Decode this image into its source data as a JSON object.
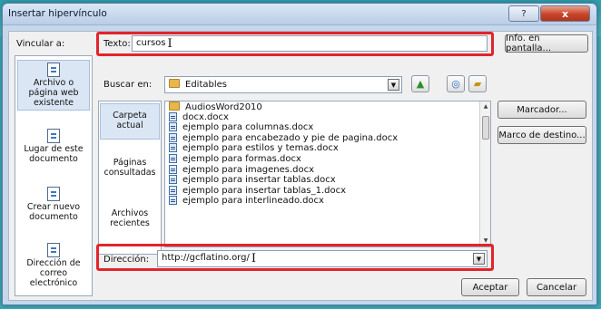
{
  "window": {
    "title": "Insertar hipervínculo",
    "help_glyph": "?",
    "close_glyph": "x"
  },
  "link_to": {
    "label": "Vincular a:",
    "items": [
      {
        "label": "Archivo o página web existente",
        "icon": "web-page-icon",
        "selected": true
      },
      {
        "label": "Lugar de este documento",
        "icon": "document-place-icon"
      },
      {
        "label": "Crear nuevo documento",
        "icon": "new-document-icon"
      },
      {
        "label": "Dirección de correo electrónico",
        "icon": "email-icon"
      }
    ]
  },
  "text_field": {
    "label": "Texto:",
    "value": "cursos"
  },
  "screentip_button": "Info. en pantalla...",
  "look_in": {
    "label": "Buscar en:",
    "value": "Editables"
  },
  "look_in_nav": [
    {
      "label": "Carpeta actual",
      "selected": true
    },
    {
      "label": "Páginas consultadas"
    },
    {
      "label": "Archivos recientes"
    }
  ],
  "files": [
    {
      "name": "AudiosWord2010",
      "type": "folder"
    },
    {
      "name": "docx.docx",
      "type": "doc"
    },
    {
      "name": "ejemplo para columnas.docx",
      "type": "doc"
    },
    {
      "name": "ejemplo para encabezado y pie de pagina.docx",
      "type": "doc"
    },
    {
      "name": "ejemplo para estilos y temas.docx",
      "type": "doc"
    },
    {
      "name": "ejemplo para formas.docx",
      "type": "doc"
    },
    {
      "name": "ejemplo para imagenes.docx",
      "type": "doc"
    },
    {
      "name": "ejemplo para insertar tablas.docx",
      "type": "doc"
    },
    {
      "name": "ejemplo para insertar tablas_1.docx",
      "type": "doc"
    },
    {
      "name": "ejemplo para interlineado.docx",
      "type": "doc"
    }
  ],
  "side_buttons": {
    "bookmark": "Marcador...",
    "target_frame": "Marco de destino..."
  },
  "address": {
    "label": "Dirección:",
    "value": "http://gcflatino.org/"
  },
  "footer": {
    "ok": "Aceptar",
    "cancel": "Cancelar"
  },
  "colors": {
    "highlight": "#e3242b",
    "dialog_frame": "#c6d7ec",
    "background": "#3aa9b7"
  }
}
